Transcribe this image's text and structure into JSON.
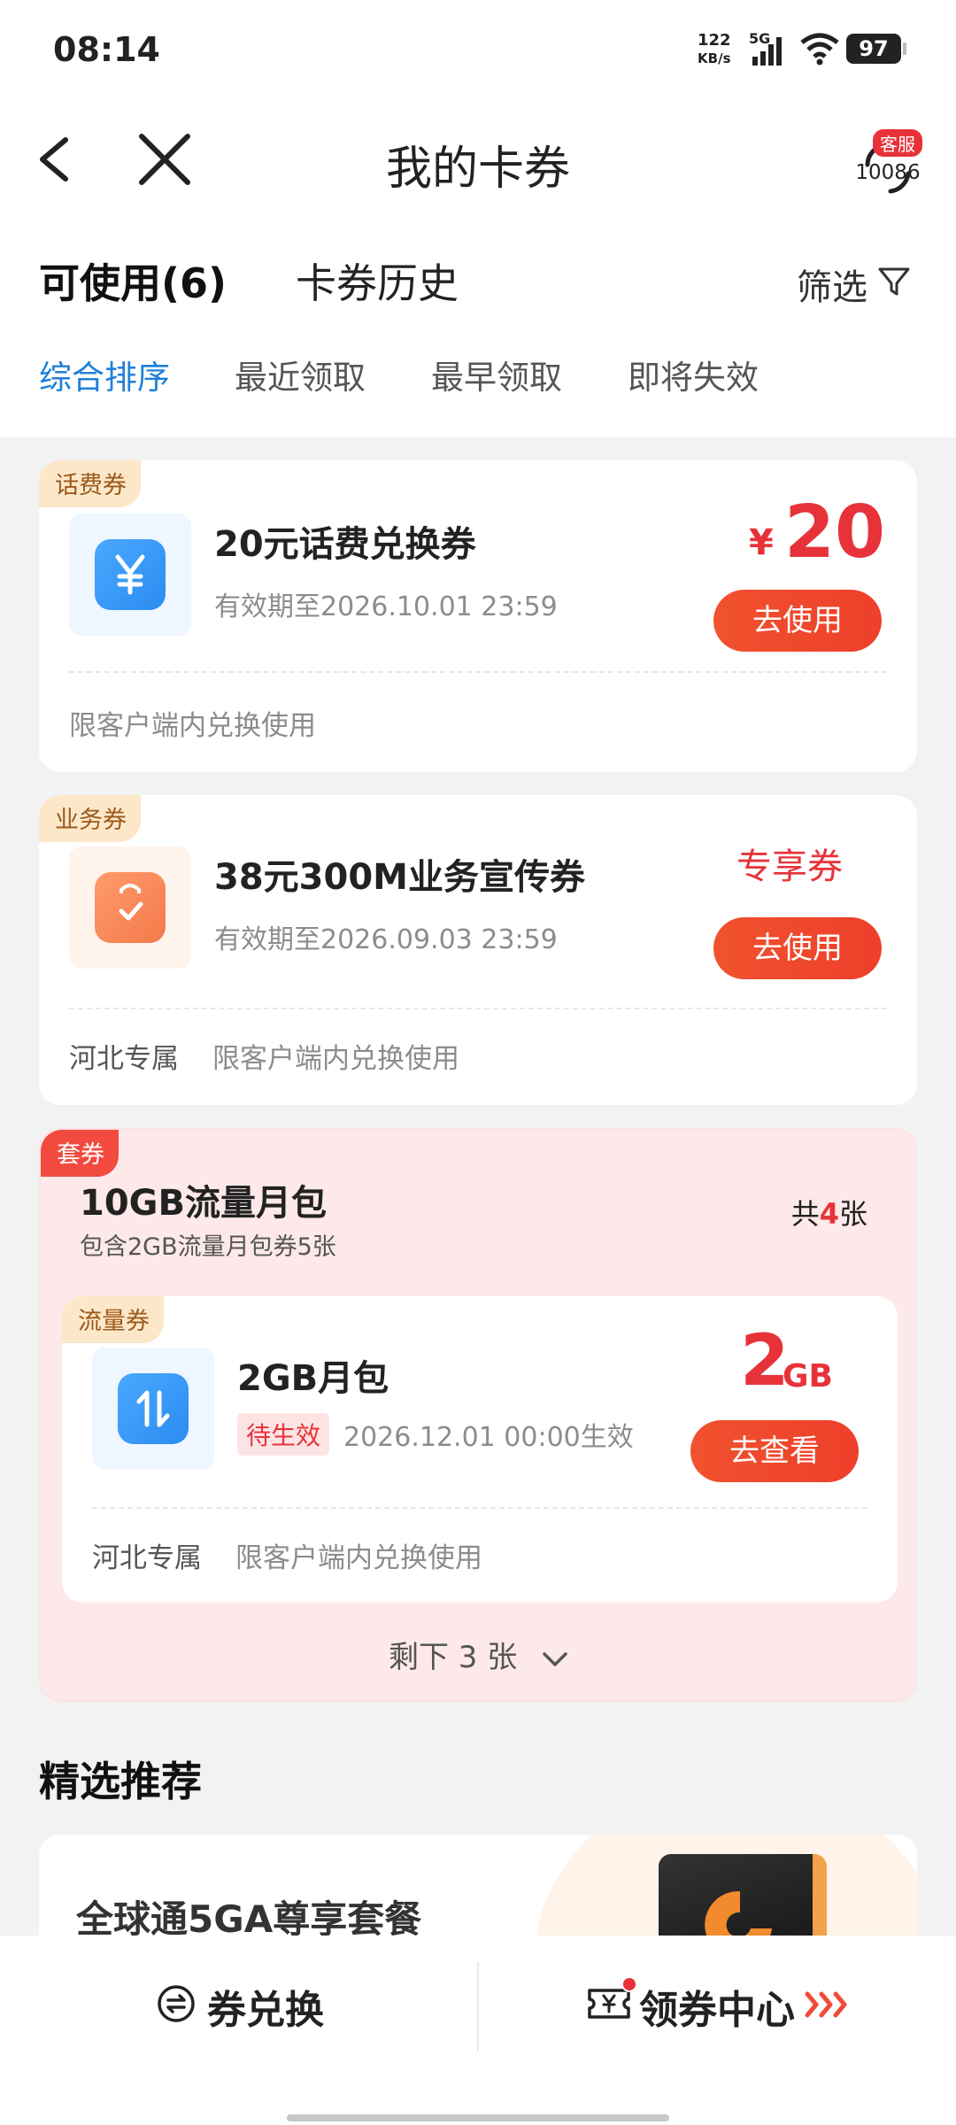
{
  "status_bar": {
    "time": "08:14",
    "net_speed_value": "122",
    "net_speed_unit": "KB/s",
    "network": "5G",
    "battery": "97"
  },
  "header": {
    "title": "我的卡券",
    "service_tag": "客服",
    "service_number": "10086"
  },
  "tabs": {
    "available": "可使用(6)",
    "history": "卡券历史",
    "filter": "筛选"
  },
  "sort_options": [
    "综合排序",
    "最近领取",
    "最早领取",
    "即将失效"
  ],
  "coupons": [
    {
      "badge": "话费券",
      "title": "20元话费兑换券",
      "expiry": "有效期至2026.10.01 23:59",
      "currency": "¥",
      "amount": "20",
      "button": "去使用",
      "note": "限客户端内兑换使用"
    },
    {
      "badge": "业务券",
      "title": "38元300M业务宣传券",
      "expiry": "有效期至2026.09.03 23:59",
      "tag": "专享券",
      "button": "去使用",
      "region": "河北专属",
      "note": "限客户端内兑换使用"
    }
  ],
  "package": {
    "badge": "套券",
    "title": "10GB流量月包",
    "subtitle": "包含2GB流量月包券5张",
    "count_prefix": "共",
    "count": "4",
    "count_suffix": "张",
    "item": {
      "badge": "流量券",
      "title": "2GB月包",
      "status": "待生效",
      "effective": "2026.12.01 00:00生效",
      "amount": "2",
      "unit": "GB",
      "button": "去查看",
      "region": "河北专属",
      "note": "限客户端内兑换使用"
    },
    "remaining": "剩下 3 张"
  },
  "recommend": {
    "title": "精选推荐",
    "promo_title": "全球通5GA尊享套餐"
  },
  "bottom_bar": {
    "exchange": "券兑换",
    "center": "领券中心"
  },
  "colors": {
    "accent_blue": "#1f80d8",
    "accent_red": "#e8323a",
    "button_orange": "#f0522f",
    "package_bg": "#fde9e9"
  }
}
